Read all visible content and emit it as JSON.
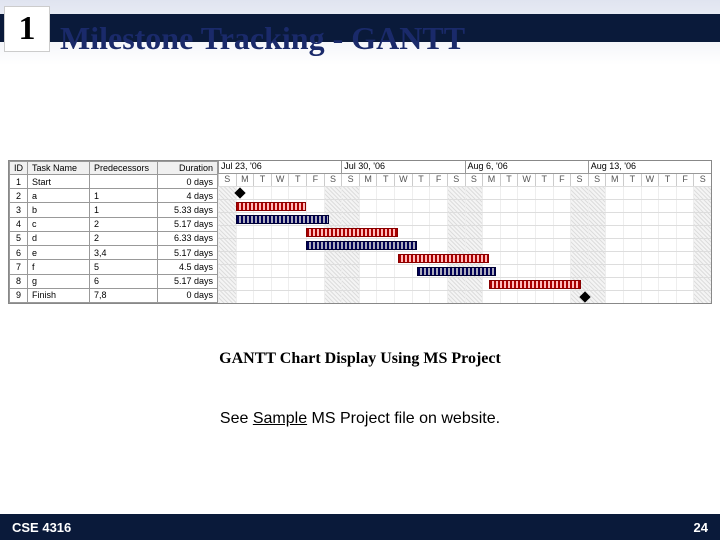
{
  "slide_number_box": "1",
  "title": "Milestone Tracking - GANTT",
  "caption": "GANTT Chart Display Using MS Project",
  "sample_prefix": "See ",
  "sample_link": "Sample",
  "sample_suffix": " MS Project file on website.",
  "footer_left": "CSE 4316",
  "footer_right": "24",
  "table": {
    "headers": {
      "id": "ID",
      "task": "Task Name",
      "pred": "Predecessors",
      "dur": "Duration"
    },
    "rows": [
      {
        "id": "1",
        "task": "Start",
        "pred": "",
        "dur": "0 days"
      },
      {
        "id": "2",
        "task": "a",
        "pred": "1",
        "dur": "4 days"
      },
      {
        "id": "3",
        "task": "b",
        "pred": "1",
        "dur": "5.33 days"
      },
      {
        "id": "4",
        "task": "c",
        "pred": "2",
        "dur": "5.17 days"
      },
      {
        "id": "5",
        "task": "d",
        "pred": "2",
        "dur": "6.33 days"
      },
      {
        "id": "6",
        "task": "e",
        "pred": "3,4",
        "dur": "5.17 days"
      },
      {
        "id": "7",
        "task": "f",
        "pred": "5",
        "dur": "4.5 days"
      },
      {
        "id": "8",
        "task": "g",
        "pred": "6",
        "dur": "5.17 days"
      },
      {
        "id": "9",
        "task": "Finish",
        "pred": "7,8",
        "dur": "0 days"
      }
    ]
  },
  "weeks": [
    "Jul 23, '06",
    "Jul 30, '06",
    "Aug 6, '06",
    "Aug 13, '06"
  ],
  "days": [
    "S",
    "M",
    "T",
    "W",
    "T",
    "F",
    "S"
  ],
  "chart_data": {
    "type": "bar",
    "title": "Gantt bars (day index from Jul 23 '06)",
    "series": [
      {
        "name": "Start",
        "start": 1,
        "end": 1,
        "milestone": true
      },
      {
        "name": "a",
        "start": 1,
        "end": 5
      },
      {
        "name": "b",
        "start": 1,
        "end": 6.3,
        "critical": false
      },
      {
        "name": "c",
        "start": 5,
        "end": 10.2
      },
      {
        "name": "d",
        "start": 5,
        "end": 11.3,
        "critical": false
      },
      {
        "name": "e",
        "start": 10.2,
        "end": 15.4
      },
      {
        "name": "f",
        "start": 11.3,
        "end": 15.8,
        "critical": false
      },
      {
        "name": "g",
        "start": 15.4,
        "end": 20.6
      },
      {
        "name": "Finish",
        "start": 20.6,
        "end": 20.6,
        "milestone": true
      }
    ],
    "total_days": 28
  }
}
